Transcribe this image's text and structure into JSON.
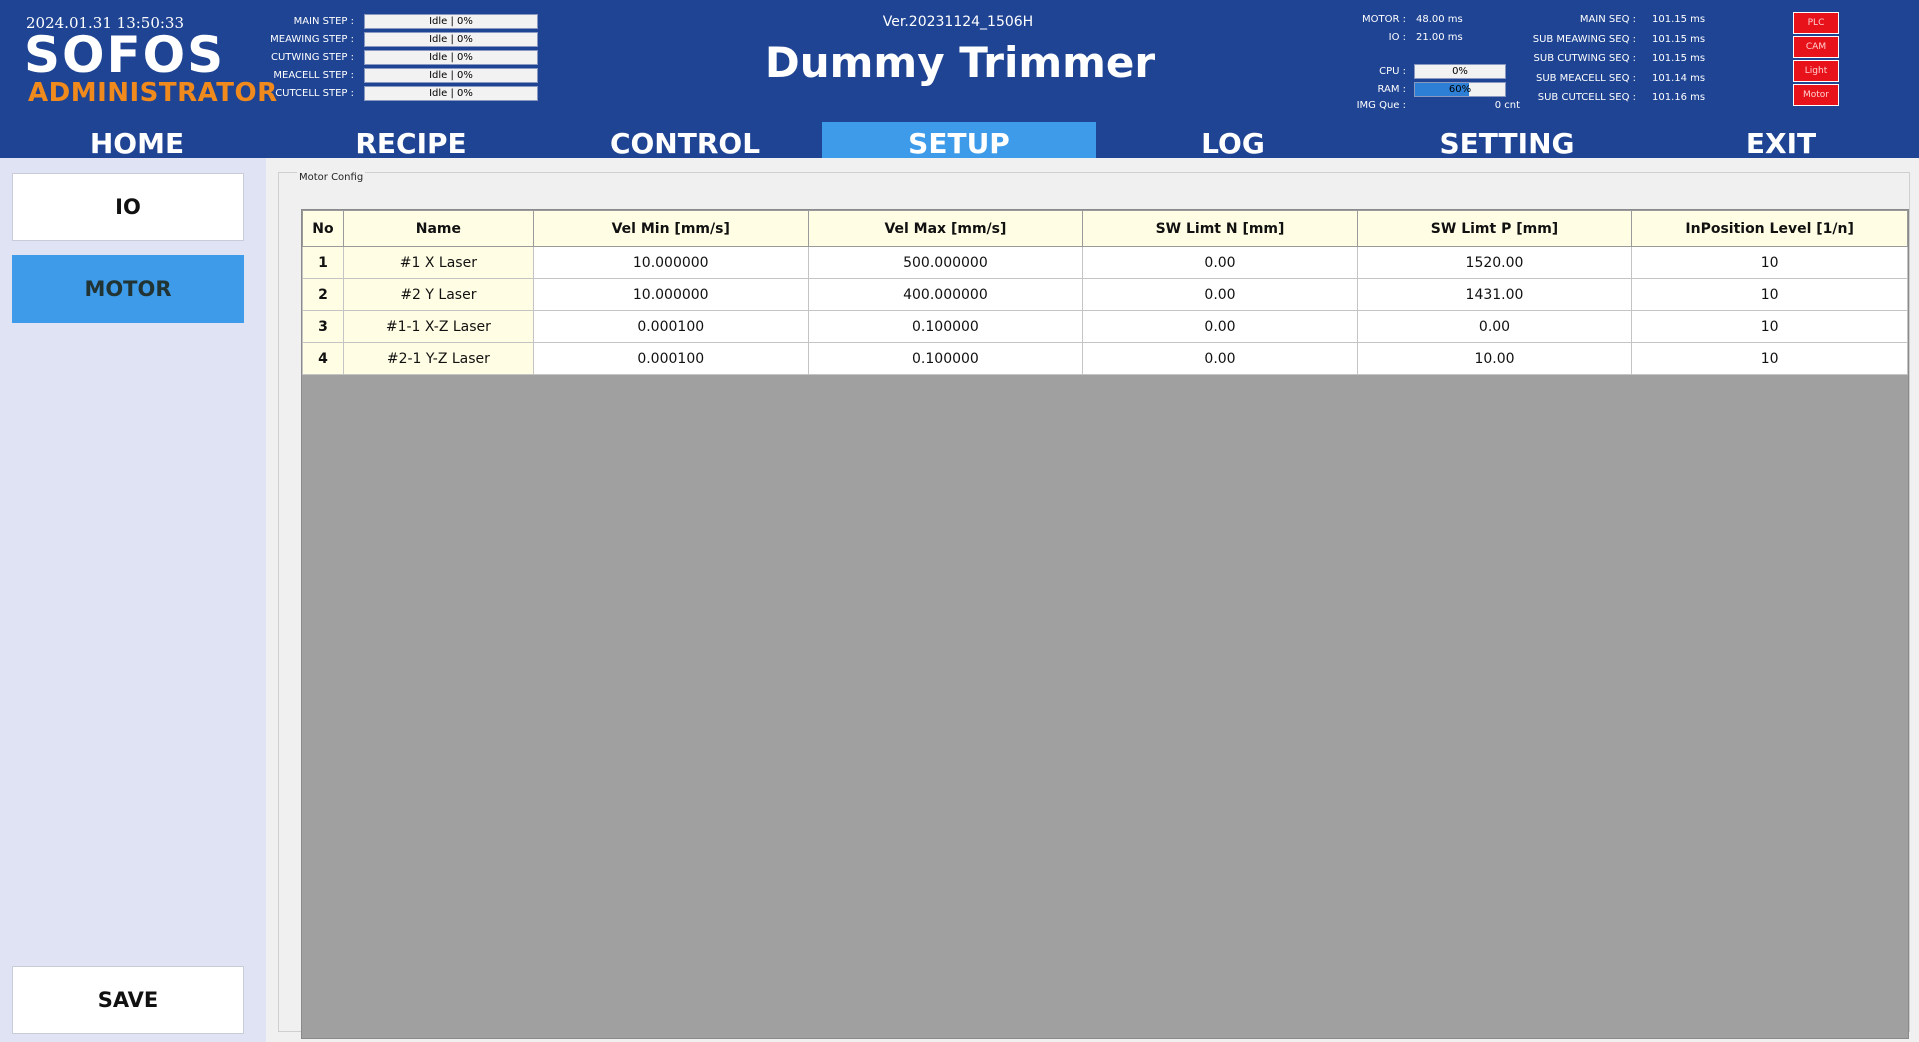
{
  "header": {
    "datetime": "2024.01.31 13:50:33",
    "logo": "SOFOS",
    "role": "ADMINISTRATOR",
    "version": "Ver.20231124_1506H",
    "title": "Dummy Trimmer",
    "steps": [
      {
        "label": "MAIN STEP :",
        "value": "Idle | 0%"
      },
      {
        "label": "MEAWING STEP :",
        "value": "Idle | 0%"
      },
      {
        "label": "CUTWING STEP :",
        "value": "Idle | 0%"
      },
      {
        "label": "MEACELL STEP :",
        "value": "Idle | 0%"
      },
      {
        "label": "CUTCELL STEP :",
        "value": "Idle | 0%"
      }
    ],
    "timing": [
      {
        "label": "MOTOR :",
        "value": "48.00 ms"
      },
      {
        "label": "IO :",
        "value": "21.00 ms"
      }
    ],
    "cpu": {
      "label": "CPU :",
      "value": "0%",
      "percent": 0
    },
    "ram": {
      "label": "RAM :",
      "value": "60%",
      "percent": 60
    },
    "img_que": {
      "label": "IMG Que :",
      "value": "0 cnt"
    },
    "seq": [
      {
        "label": "MAIN SEQ :",
        "value": "101.15 ms"
      },
      {
        "label": "SUB MEAWING SEQ :",
        "value": "101.15 ms"
      },
      {
        "label": "SUB CUTWING SEQ :",
        "value": "101.15 ms"
      },
      {
        "label": "SUB MEACELL SEQ :",
        "value": "101.14 ms"
      },
      {
        "label": "SUB CUTCELL SEQ :",
        "value": "101.16 ms"
      }
    ],
    "indicators": [
      "PLC",
      "CAM",
      "Light",
      "Motor"
    ],
    "indicator_color": "#e8121a"
  },
  "nav": {
    "tabs": [
      "HOME",
      "RECIPE",
      "CONTROL",
      "SETUP",
      "LOG",
      "SETTING",
      "EXIT"
    ],
    "active": "SETUP",
    "active_color": "#3d9be9"
  },
  "sidebar": {
    "io_label": "IO",
    "motor_label": "MOTOR",
    "save_label": "SAVE"
  },
  "motor_config": {
    "title": "Motor Config",
    "columns": [
      "No",
      "Name",
      "Vel Min [mm/s]",
      "Vel Max [mm/s]",
      "SW Limt N [mm]",
      "SW Limt P [mm]",
      "InPosition Level [1/n]"
    ],
    "rows": [
      [
        "1",
        "#1 X Laser",
        "10.000000",
        "500.000000",
        "0.00",
        "1520.00",
        "10"
      ],
      [
        "2",
        "#2 Y Laser",
        "10.000000",
        "400.000000",
        "0.00",
        "1431.00",
        "10"
      ],
      [
        "3",
        "#1-1 X-Z Laser",
        "0.000100",
        "0.100000",
        "0.00",
        "0.00",
        "10"
      ],
      [
        "4",
        "#2-1 Y-Z Laser",
        "0.000100",
        "0.100000",
        "0.00",
        "10.00",
        "10"
      ]
    ]
  }
}
